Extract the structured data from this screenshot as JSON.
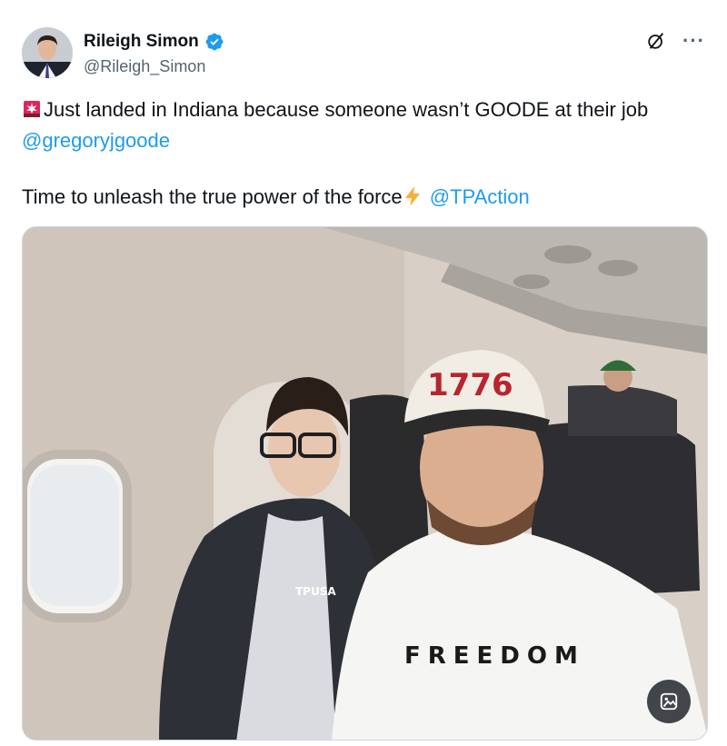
{
  "author": {
    "display_name": "Rileigh Simon",
    "handle": "@Rileigh_Simon",
    "verified": true
  },
  "tweet": {
    "line1_text": "Just landed in Indiana because someone wasn’t GOODE at their job",
    "line1_mention": "@gregoryjgoode",
    "line2_text": "Time to unleash the true power of the force",
    "line2_mention": "@TPAction",
    "emoji": [
      "siren-icon",
      "lightning-bolt-icon"
    ]
  },
  "media": {
    "description_icons": [
      "airplane-window",
      "seats"
    ],
    "cap_text": "1776",
    "shirt_text": "FREEDOM",
    "jacket_logo": "TPUSA"
  },
  "colors": {
    "link": "#1d9bf0",
    "verified": "#1d9bf0",
    "secondary_text": "#536471"
  }
}
